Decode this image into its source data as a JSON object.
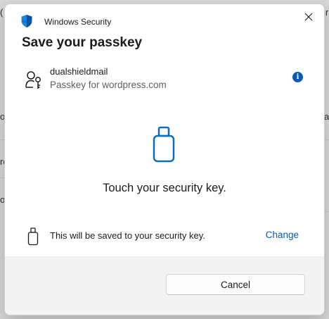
{
  "background": {
    "left_fragments": [
      "(",
      "ou",
      "re",
      "o"
    ],
    "right_fragments": [
      "ir",
      "a"
    ]
  },
  "window": {
    "app_title": "Windows Security",
    "app_icon": "shield-icon",
    "close_icon": "close-icon"
  },
  "dialog": {
    "heading": "Save your passkey",
    "account": {
      "name": "dualshieldmail",
      "subtitle": "Passkey for wordpress.com",
      "icon": "person-key-icon",
      "info_glyph": "i"
    },
    "instruction": "Touch your security key.",
    "storage": {
      "text": "This will be saved to your security key.",
      "change_label": "Change",
      "icon": "usb-key-icon"
    },
    "footer": {
      "cancel_label": "Cancel"
    }
  },
  "colors": {
    "accent": "#0a5bb5",
    "key_blue": "#0f6cbd",
    "footer_bg": "#f3f3f3"
  }
}
